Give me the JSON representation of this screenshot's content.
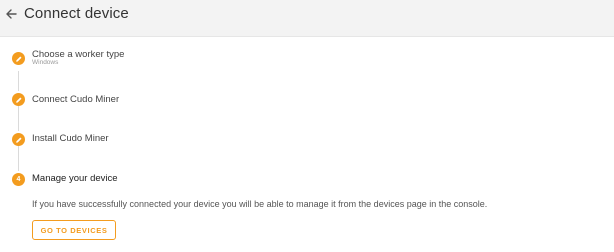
{
  "header": {
    "title": "Connect device",
    "back_icon": "arrow-left-icon"
  },
  "steps": [
    {
      "title": "Choose a worker type",
      "subtitle": "Windows",
      "status": "completed",
      "icon": "pencil-icon"
    },
    {
      "title": "Connect Cudo Miner",
      "status": "completed",
      "icon": "pencil-icon"
    },
    {
      "title": "Install Cudo Miner",
      "status": "completed",
      "icon": "pencil-icon"
    },
    {
      "title": "Manage your device",
      "number": "4",
      "status": "active",
      "description": "If you have successfully connected your device you will be able to manage it from the devices page in the console.",
      "action_label": "GO TO DEVICES"
    }
  ],
  "colors": {
    "accent": "#f39c1f",
    "header_bg": "#f3f3f3",
    "connector": "#dadada"
  }
}
